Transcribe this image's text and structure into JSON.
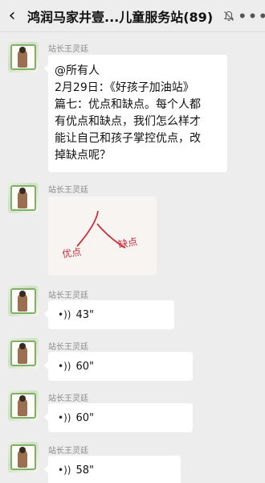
{
  "header": {
    "back_icon": "back-chevron-icon",
    "title": "鸿润马家井壹...儿童服务站(89)",
    "bell_icon": "bell-muted-icon",
    "more_icon": "more-dots-icon"
  },
  "messages": [
    {
      "sender": "站长王灵廷",
      "type": "text",
      "lines": [
        "@所有人",
        "2月29日：《好孩子加油站》",
        "篇七：优点和缺点。每个人都",
        "有优点和缺点，我们怎么样才",
        "能让自己和孩子掌控优点，改",
        "掉缺点呢？"
      ]
    },
    {
      "sender": "站长王灵廷",
      "type": "image",
      "image_text": {
        "char": "人",
        "left": "优点",
        "right": "缺点"
      }
    },
    {
      "sender": "站长王灵廷",
      "type": "voice",
      "duration": "43\""
    },
    {
      "sender": "站长王灵廷",
      "type": "voice",
      "duration": "60\""
    },
    {
      "sender": "站长王灵廷",
      "type": "voice",
      "duration": "60\""
    },
    {
      "sender": "站长王灵廷",
      "type": "voice",
      "duration": "58\""
    }
  ]
}
